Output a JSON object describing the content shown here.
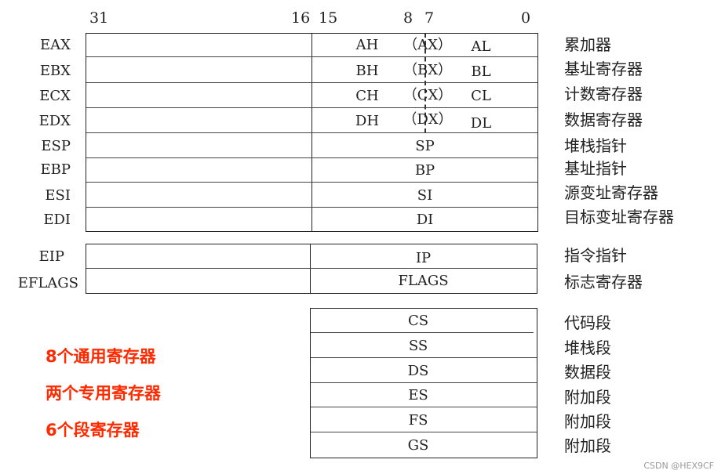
{
  "bit_positions": [
    "31",
    "16",
    "15",
    "8",
    "7",
    "0"
  ],
  "general_registers": [
    {
      "name": "EAX",
      "high": "AH",
      "word": "（AX）",
      "low": "AL",
      "desc": "累加器"
    },
    {
      "name": "EBX",
      "high": "BH",
      "word": "（BX）",
      "low": "BL",
      "desc": "基址寄存器"
    },
    {
      "name": "ECX",
      "high": "CH",
      "word": "（CX）",
      "low": "CL",
      "desc": "计数寄存器"
    },
    {
      "name": "EDX",
      "high": "DH",
      "word": "（DX）",
      "low": "DL",
      "desc": "数据寄存器"
    },
    {
      "name": "ESP",
      "word": "SP",
      "desc": "堆栈指针"
    },
    {
      "name": "EBP",
      "word": "BP",
      "desc": "基址指针"
    },
    {
      "name": "ESI",
      "word": "SI",
      "desc": "源变址寄存器"
    },
    {
      "name": "EDI",
      "word": "DI",
      "desc": "目标变址寄存器"
    }
  ],
  "special_registers": [
    {
      "name": "EIP",
      "word": "IP",
      "desc": "指令指针"
    },
    {
      "name": "EFLAGS",
      "word": "FLAGS",
      "desc": "标志寄存器"
    }
  ],
  "segment_registers": [
    {
      "name": "CS",
      "desc": "代码段"
    },
    {
      "name": "SS",
      "desc": "堆栈段"
    },
    {
      "name": "DS",
      "desc": "数据段"
    },
    {
      "name": "ES",
      "desc": "附加段"
    },
    {
      "name": "FS",
      "desc": "附加段"
    },
    {
      "name": "GS",
      "desc": "附加段"
    }
  ],
  "notes": [
    "8个通用寄存器",
    "两个专用寄存器",
    "6个段寄存器"
  ],
  "note_color": "#ff2a00",
  "watermark": "CSDN @HEX9CF"
}
